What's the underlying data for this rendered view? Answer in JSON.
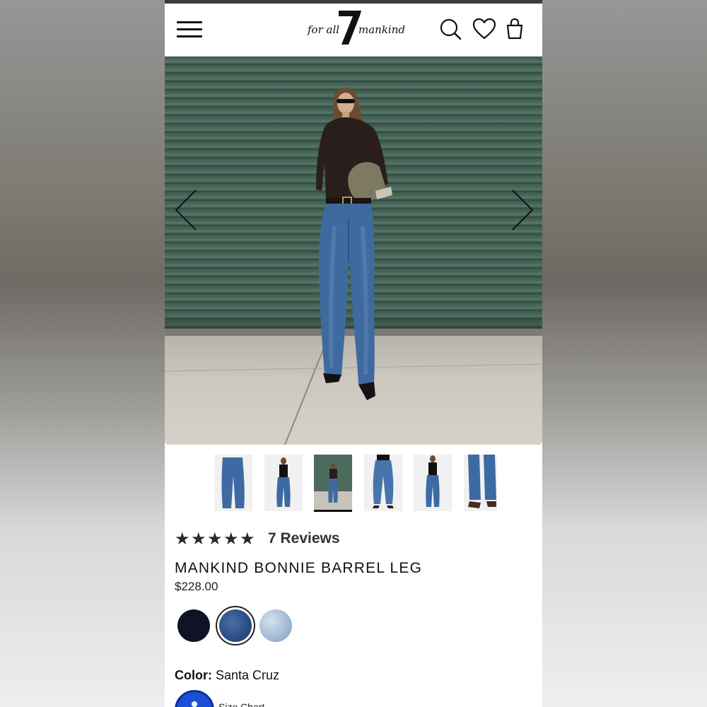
{
  "header": {
    "logo_text_left": "for all",
    "logo_numeral": "7",
    "logo_text_right": "mankind",
    "icons": [
      "menu-icon",
      "search-icon",
      "heart-icon",
      "shopping-bag-icon"
    ]
  },
  "gallery": {
    "arrows": [
      "chevron-left-icon",
      "chevron-right-icon"
    ],
    "thumbnail_count": 6,
    "active_thumbnail": 3
  },
  "product": {
    "rating": 5,
    "reviews_label": "7 Reviews",
    "title": "MANKIND BONNIE BARREL LEG",
    "price": "$228.00",
    "swatches": [
      {
        "color": "#0f1326",
        "selected": false
      },
      {
        "color": "#2d4f86",
        "selected": true
      },
      {
        "color": "#a9bfd8",
        "selected": false
      }
    ],
    "color_label": "Color:",
    "color_value": "Santa Cruz",
    "size_chart_label": "Size Chart"
  }
}
